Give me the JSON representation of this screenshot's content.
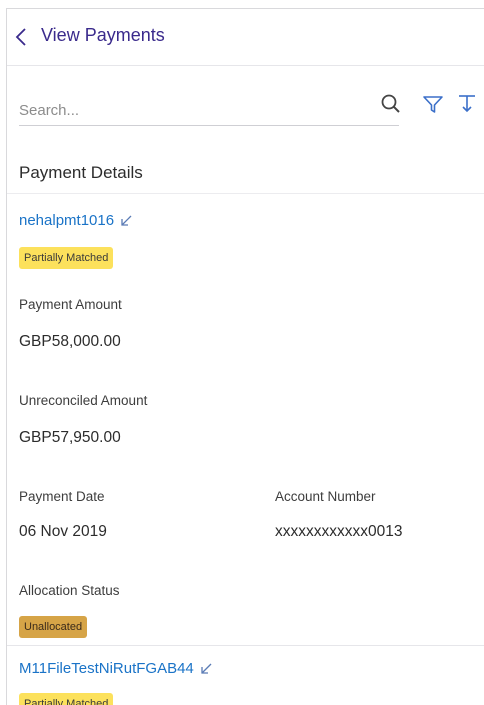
{
  "header": {
    "title": "View Payments"
  },
  "search": {
    "placeholder": "Search..."
  },
  "section": {
    "title": "Payment Details"
  },
  "payments": [
    {
      "reference": "nehalpmt1016",
      "match_status": "Partially Matched",
      "payment_amount_label": "Payment Amount",
      "payment_amount": "GBP58,000.00",
      "unreconciled_amount_label": "Unreconciled Amount",
      "unreconciled_amount": "GBP57,950.00",
      "payment_date_label": "Payment Date",
      "payment_date": "06 Nov 2019",
      "account_number_label": "Account Number",
      "account_number": "xxxxxxxxxxxx0013",
      "allocation_status_label": "Allocation Status",
      "allocation_status": "Unallocated"
    },
    {
      "reference": "M11FileTestNiRutFGAB44",
      "match_status": "Partially Matched"
    }
  ],
  "colors": {
    "title": "#3a2a8c",
    "link": "#1a73c7",
    "icon": "#3b6fc9",
    "badge_matched": "#fce15c",
    "badge_unallocated": "#d6a447"
  }
}
